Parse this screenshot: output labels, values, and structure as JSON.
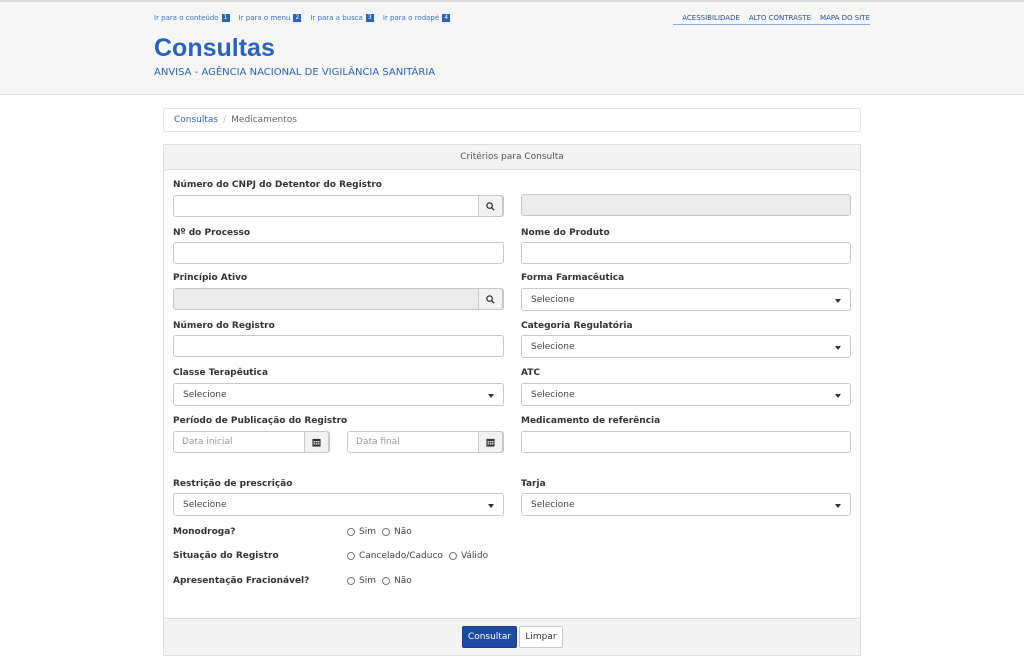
{
  "accessibility_links": [
    {
      "label": "Ir para o conteúdo",
      "num": "1"
    },
    {
      "label": "Ir para o menu",
      "num": "2"
    },
    {
      "label": "Ir para a busca",
      "num": "3"
    },
    {
      "label": "Ir para o rodapé",
      "num": "4"
    }
  ],
  "top_links": [
    "ACESSIBILIDADE",
    "ALTO CONTRASTE",
    "MAPA DO SITE"
  ],
  "header": {
    "title": "Consultas",
    "subtitle": "ANVISA - AGÊNCIA NACIONAL DE VIGILÂNCIA SANITÁRIA"
  },
  "breadcrumb": {
    "link": "Consultas",
    "separator": "/",
    "current": "Medicamentos"
  },
  "panel": {
    "title": "Critérios para Consulta"
  },
  "form": {
    "cnpj_label": "Número do CNPJ do Detentor do Registro",
    "processo_label": "Nº do Processo",
    "produto_label": "Nome do Produto",
    "principio_label": "Princípio Ativo",
    "forma_label": "Forma Farmacêutica",
    "registro_label": "Número do Registro",
    "categoria_label": "Categoria Regulatória",
    "classe_label": "Classe Terapêutica",
    "atc_label": "ATC",
    "periodo_label": "Período de Publicação do Registro",
    "referencia_label": "Medicamento de referência",
    "restricao_label": "Restrição de prescrição",
    "tarja_label": "Tarja",
    "data_inicial_placeholder": "Data inicial",
    "data_final_placeholder": "Data final",
    "select_default": "Selecione",
    "monodroga_label": "Monodroga?",
    "monodroga_options": [
      "Sim",
      "Não"
    ],
    "situacao_label": "Situação do Registro",
    "situacao_options": [
      "Cancelado/Caduco",
      "Válido"
    ],
    "fracionavel_label": "Apresentação Fracionável?",
    "fracionavel_options": [
      "Sim",
      "Não"
    ]
  },
  "buttons": {
    "consultar": "Consultar",
    "limpar": "Limpar"
  },
  "colors": {
    "brand_blue": "#2d62b9",
    "primary_button": "#1f4aa3"
  }
}
